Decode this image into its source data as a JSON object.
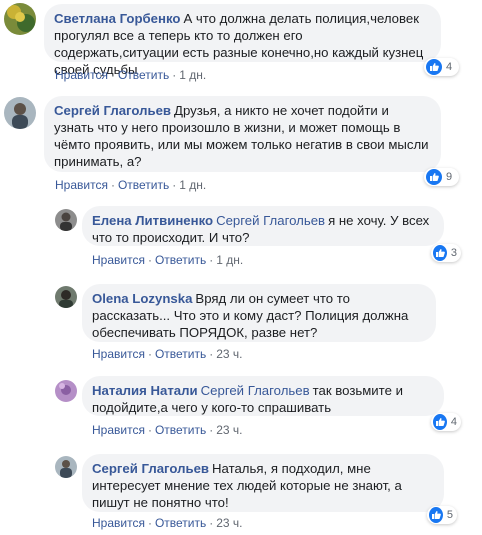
{
  "actions": {
    "like": "Нравится",
    "reply": "Ответить",
    "separator": "·"
  },
  "colors": {
    "link": "#385898",
    "bubble": "#f2f3f5",
    "like_badge": "#1877f2"
  },
  "comments": [
    {
      "author": "Светлана Горбенко",
      "mention": "",
      "text": "А что должна делать полиция,человек прогулял все а теперь кто то должен его содержать,ситуации есть разные конечно,но каждый кузнец своей судьбы",
      "time": "1 дн.",
      "reactions": "4",
      "reaction_icon": "thumbs-up-icon"
    },
    {
      "author": "Сергей Глагольев",
      "mention": "",
      "text": "Друзья, а никто не хочет подойти и узнать что у него произошло в жизни, и может помощь в чёмто проявить, или мы можем только негатив в свои мысли принимать, а?",
      "time": "1 дн.",
      "reactions": "9",
      "reaction_icon": "thumbs-up-icon"
    },
    {
      "author": "Елена Литвиненко",
      "mention": "Сергей Глагольев",
      "text": "я не хочу. У всех что то происходит. И что?",
      "time": "1 дн.",
      "reactions": "3",
      "reaction_icon": "thumbs-up-icon"
    },
    {
      "author": "Olena Lozynska",
      "mention": "",
      "text": "Вряд ли он сумеет что то рассказать... Что это и кому даст? Полиция должна обеспечивать ПОРЯДОК, разве нет?",
      "time": "23 ч.",
      "reactions": "",
      "reaction_icon": ""
    },
    {
      "author": "Наталия Натали",
      "mention": "Сергей Глагольев",
      "text": "так возьмите и подойдите,а чего у кого-то спрашивать",
      "time": "23 ч.",
      "reactions": "4",
      "reaction_icon": "thumbs-up-icon"
    },
    {
      "author": "Сергей Глагольев",
      "mention": "",
      "text": "Наталья, я подходил, мне интересует мнение тех людей которые не знают, а пишут не понятно что!",
      "time": "23 ч.",
      "reactions": "5",
      "reaction_icon": "thumbs-up-icon"
    }
  ]
}
